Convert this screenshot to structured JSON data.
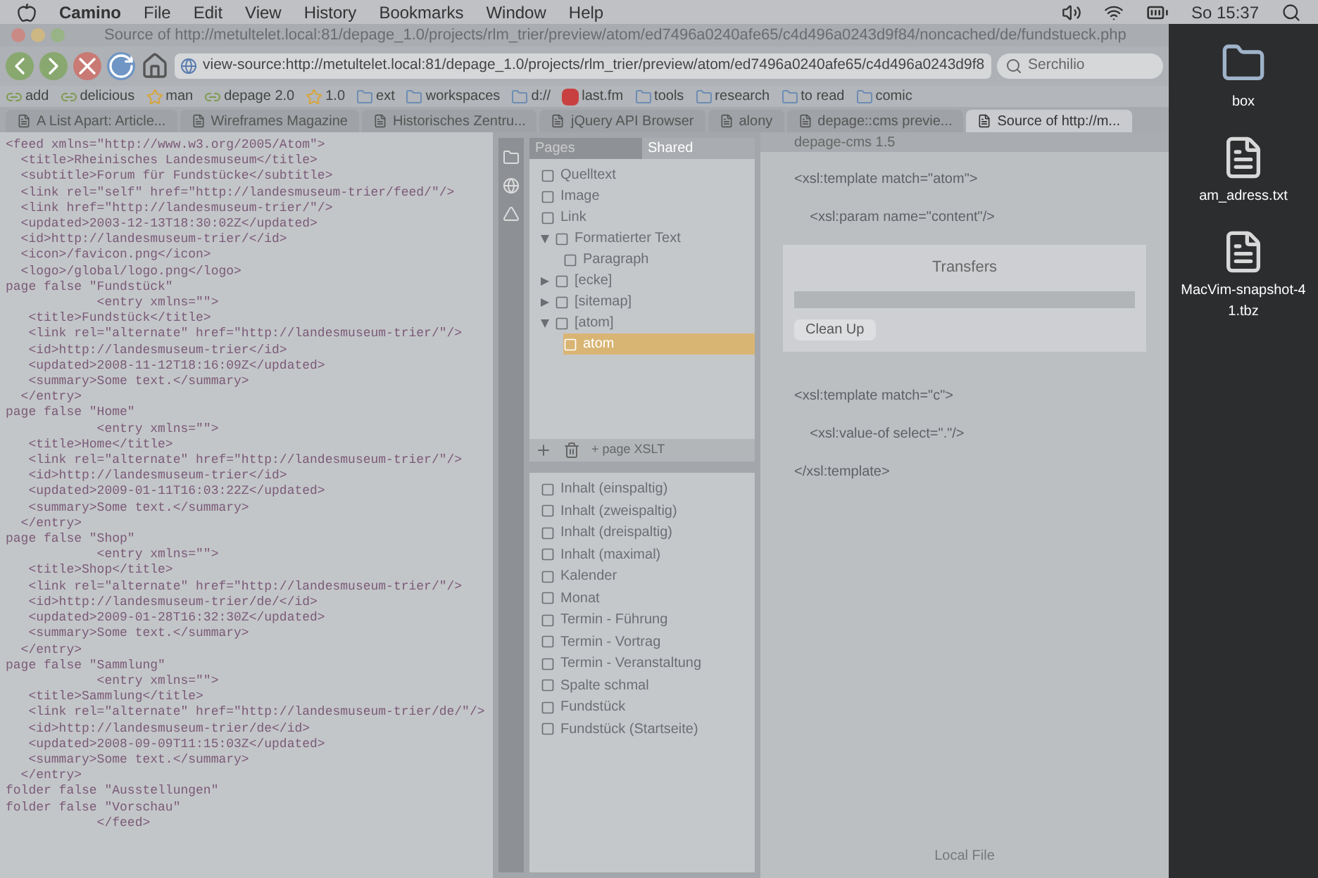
{
  "menu_bar": {
    "items": [
      "Camino",
      "File",
      "Edit",
      "View",
      "History",
      "Bookmarks",
      "Window",
      "Help"
    ],
    "clock": "So 15:37"
  },
  "browser": {
    "title": "Source of http://metultelet.local:81/depage_1.0/projects/rlm_trier/preview/atom/ed7496a0240afe65/c4d496a0243d9f84/noncached/de/fundstueck.php",
    "url": "view-source:http://metultelet.local:81/depage_1.0/projects/rlm_trier/preview/atom/ed7496a0240afe65/c4d496a0243d9f8",
    "search": {
      "placeholder": "Serchilio"
    },
    "bookmarks": [
      {
        "kind": "link",
        "label": "add"
      },
      {
        "kind": "link",
        "label": "delicious"
      },
      {
        "kind": "star",
        "label": "man"
      },
      {
        "kind": "link",
        "label": "depage 2.0"
      },
      {
        "kind": "star",
        "label": "1.0"
      },
      {
        "kind": "folder",
        "label": "ext"
      },
      {
        "kind": "folder",
        "label": "workspaces"
      },
      {
        "kind": "folder",
        "label": "d://"
      },
      {
        "kind": "site",
        "label": "last.fm"
      },
      {
        "kind": "folder",
        "label": "tools"
      },
      {
        "kind": "folder",
        "label": "research"
      },
      {
        "kind": "folder",
        "label": "to read"
      },
      {
        "kind": "folder",
        "label": "comic"
      }
    ],
    "tabs": [
      {
        "label": "A List Apart: Article...",
        "selected": false
      },
      {
        "label": "Wireframes Magazine",
        "selected": false
      },
      {
        "label": "Historisches Zentru...",
        "selected": false
      },
      {
        "label": "jQuery API Browser",
        "selected": false
      },
      {
        "label": "alony",
        "selected": false
      },
      {
        "label": "depage::cms previe...",
        "selected": false
      },
      {
        "label": "Source of http://m...",
        "selected": true
      }
    ],
    "source_lines": [
      "<feed xmlns=\"http://www.w3.org/2005/Atom\">",
      "  <title>Rheinisches Landesmuseum</title>",
      "  <subtitle>Forum für Fundstücke</subtitle>",
      "  <link rel=\"self\" href=\"http://landesmuseum-trier/feed/\"/>",
      "  <link href=\"http://landesmuseum-trier/\"/>",
      "  <updated>2003-12-13T18:30:02Z</updated>",
      "  <id>http://landesmuseum-trier/</id>",
      "  <icon>/favicon.png</icon>",
      "  <logo>/global/logo.png</logo>",
      "page false \"Fundstück\"",
      "            <entry xmlns=\"\">",
      "   <title>Fundstück</title>",
      "   <link rel=\"alternate\" href=\"http://landesmuseum-trier/\"/>",
      "   <id>http://landesmuseum-trier</id>",
      "   <updated>2008-11-12T18:16:09Z</updated>",
      "   <summary>Some text.</summary>",
      "  </entry>",
      "page false \"Home\"",
      "            <entry xmlns=\"\">",
      "   <title>Home</title>",
      "   <link rel=\"alternate\" href=\"http://landesmuseum-trier/\"/>",
      "   <id>http://landesmuseum-trier</id>",
      "   <updated>2009-01-11T16:03:22Z</updated>",
      "   <summary>Some text.</summary>",
      "  </entry>",
      "page false \"Shop\"",
      "            <entry xmlns=\"\">",
      "   <title>Shop</title>",
      "   <link rel=\"alternate\" href=\"http://landesmuseum-trier/\"/>",
      "   <id>http://landesmuseum-trier/de/</id>",
      "   <updated>2009-01-28T16:32:30Z</updated>",
      "   <summary>Some text.</summary>",
      "  </entry>",
      "page false \"Sammlung\"",
      "            <entry xmlns=\"\">",
      "   <title>Sammlung</title>",
      "   <link rel=\"alternate\" href=\"http://landesmuseum-trier/de/\"/>",
      "   <id>http://landesmuseum-trier/de</id>",
      "   <updated>2008-09-09T11:15:03Z</updated>",
      "   <summary>Some text.</summary>",
      "  </entry>",
      "folder false \"Ausstellungen\"",
      "folder false \"Vorschau\"",
      "            </feed>"
    ]
  },
  "editor_panel": {
    "tree_tabs": [
      {
        "label": "Pages",
        "selected": false
      },
      {
        "label": "Shared",
        "selected": true
      }
    ],
    "tree": [
      {
        "label": "Quelltext",
        "selected": false
      },
      {
        "label": "Image",
        "selected": false
      },
      {
        "label": "Link",
        "selected": false
      },
      {
        "label": "Formatierter Text",
        "selected": false,
        "expanded": true,
        "children": [
          {
            "label": "Paragraph",
            "selected": false
          }
        ]
      },
      {
        "label": "[ecke]",
        "selected": false,
        "expanded": false
      },
      {
        "label": "[sitemap]",
        "selected": false,
        "expanded": false
      },
      {
        "label": "[atom]",
        "selected": false,
        "expanded": true,
        "children": [
          {
            "label": "atom",
            "selected": true
          }
        ]
      }
    ],
    "tree_footer": "+ page XSLT",
    "templates": [
      "Inhalt (einspaltig)",
      "Inhalt (zweispaltig)",
      "Inhalt (dreispaltig)",
      "Inhalt (maximal)",
      "Kalender",
      "Monat",
      "Termin - Führung",
      "Termin - Vortrag",
      "Termin - Veranstaltung",
      "Spalte schmal",
      "Fundstück",
      "Fundstück (Startseite)"
    ]
  },
  "xslt_window": {
    "title": "depage-cms 1.5",
    "lines": [
      "<xsl:template match=\"atom\">",
      "    <xsl:param name=\"content\"/>",
      "<xsl:template match=\"c\">",
      "    <xsl:value-of select=\".\"/>",
      "</xsl:template>"
    ],
    "transfers": {
      "title": "Transfers",
      "button": "Clean Up",
      "status": "Local File"
    }
  },
  "desktop_icons": [
    {
      "kind": "folder",
      "label": "box"
    },
    {
      "kind": "file",
      "label": "am_adress.txt"
    },
    {
      "kind": "file",
      "label": "MacVim-snapshot-41.tbz"
    }
  ]
}
